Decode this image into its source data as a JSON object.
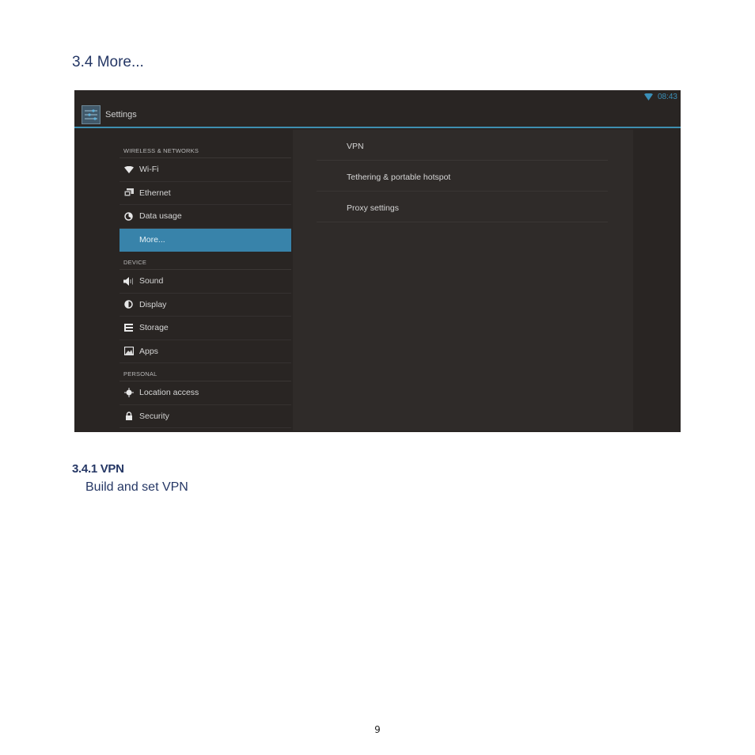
{
  "document": {
    "heading": "3.4 More...",
    "subheading": "3.4.1 VPN",
    "body": "Build and set VPN",
    "page_number": "9"
  },
  "screenshot": {
    "status_bar": {
      "time": "08:43",
      "wifi_icon": "wifi-signal-icon"
    },
    "action_bar": {
      "title": "Settings",
      "icon": "settings-sliders-icon"
    },
    "accent_color": "#3883aa",
    "left_pane": {
      "sections": [
        {
          "category": "WIRELESS & NETWORKS",
          "items": [
            {
              "label": "Wi-Fi",
              "icon": "wifi-icon"
            },
            {
              "label": "Ethernet",
              "icon": "ethernet-icon"
            },
            {
              "label": "Data usage",
              "icon": "data-usage-icon"
            },
            {
              "label": "More...",
              "icon": "",
              "selected": true
            }
          ]
        },
        {
          "category": "DEVICE",
          "items": [
            {
              "label": "Sound",
              "icon": "sound-icon"
            },
            {
              "label": "Display",
              "icon": "display-icon"
            },
            {
              "label": "Storage",
              "icon": "storage-icon"
            },
            {
              "label": "Apps",
              "icon": "apps-icon"
            }
          ]
        },
        {
          "category": "PERSONAL",
          "items": [
            {
              "label": "Location access",
              "icon": "location-icon"
            },
            {
              "label": "Security",
              "icon": "lock-icon"
            }
          ]
        }
      ]
    },
    "right_pane": {
      "items": [
        {
          "label": "VPN"
        },
        {
          "label": "Tethering & portable hotspot"
        },
        {
          "label": "Proxy settings"
        }
      ]
    }
  }
}
